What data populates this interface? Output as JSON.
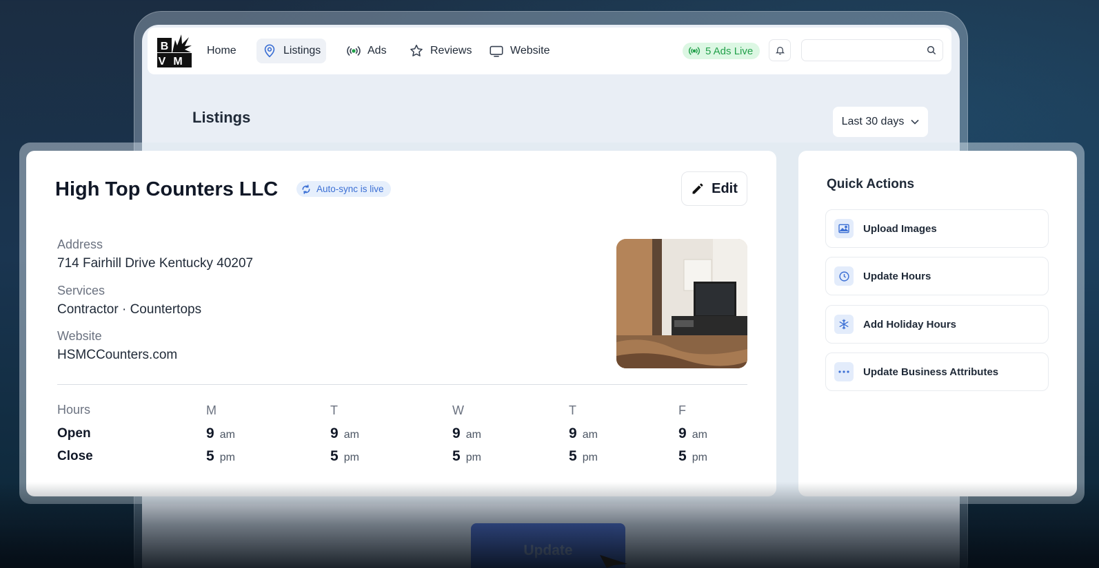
{
  "nav": {
    "logo_text": "BVM",
    "items": [
      {
        "label": "Home",
        "icon": "none"
      },
      {
        "label": "Listings",
        "icon": "map-pin-icon",
        "active": true
      },
      {
        "label": "Ads",
        "icon": "broadcast-icon"
      },
      {
        "label": "Reviews",
        "icon": "star-icon"
      },
      {
        "label": "Website",
        "icon": "monitor-icon"
      }
    ],
    "ads_live": "5 Ads Live",
    "search_placeholder": ""
  },
  "page": {
    "title": "Listings",
    "date_range": "Last 30 days"
  },
  "listing": {
    "name": "High Top Counters LLC",
    "sync_status": "Auto-sync is live",
    "edit_label": "Edit",
    "address_label": "Address",
    "address": "714 Fairhill Drive Kentucky 40207",
    "services_label": "Services",
    "services": "Contractor · Countertops",
    "website_label": "Website",
    "website": "HSMCCounters.com",
    "hours": {
      "label": "Hours",
      "open_label": "Open",
      "close_label": "Close",
      "days": [
        {
          "day": "M",
          "open": "9",
          "open_ap": "am",
          "close": "5",
          "close_ap": "pm"
        },
        {
          "day": "T",
          "open": "9",
          "open_ap": "am",
          "close": "5",
          "close_ap": "pm"
        },
        {
          "day": "W",
          "open": "9",
          "open_ap": "am",
          "close": "5",
          "close_ap": "pm"
        },
        {
          "day": "T",
          "open": "9",
          "open_ap": "am",
          "close": "5",
          "close_ap": "pm"
        },
        {
          "day": "F",
          "open": "9",
          "open_ap": "am",
          "close": "5",
          "close_ap": "pm"
        }
      ]
    }
  },
  "quick_actions": {
    "title": "Quick Actions",
    "items": [
      {
        "label": "Upload Images",
        "icon": "image-icon"
      },
      {
        "label": "Update Hours",
        "icon": "clock-icon"
      },
      {
        "label": "Add Holiday Hours",
        "icon": "snowflake-icon"
      },
      {
        "label": "Update Business Attributes",
        "icon": "more-icon"
      }
    ]
  },
  "update_button": "Update",
  "colors": {
    "accent_blue": "#3b6fd4",
    "live_green": "#22a04a",
    "button_blue": "#1f47c9"
  }
}
